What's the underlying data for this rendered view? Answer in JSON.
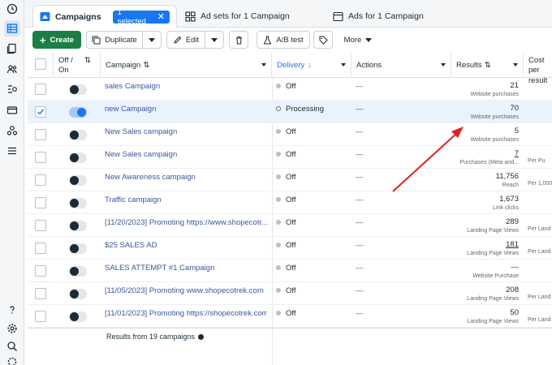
{
  "tabs": {
    "campaigns": "Campaigns",
    "selected_badge": "1 selected",
    "adsets": "Ad sets for 1 Campaign",
    "ads": "Ads for 1 Campaign"
  },
  "toolbar": {
    "create": "Create",
    "duplicate": "Duplicate",
    "edit": "Edit",
    "abtest": "A/B test",
    "more": "More"
  },
  "columns": {
    "offon": "Off / On",
    "campaign": "Campaign",
    "delivery": "Delivery",
    "actions": "Actions",
    "results": "Results",
    "cost": "Cost per result"
  },
  "rows": [
    {
      "name": "sales Campaign",
      "delivery": "Off",
      "action": "—",
      "result": "21",
      "result_label": "Website purchases",
      "cost_label": "",
      "toggle": false,
      "checked": false
    },
    {
      "name": "new Campaign",
      "delivery": "Processing",
      "action": "—",
      "result": "70",
      "result_label": "Website purchases",
      "cost_label": "",
      "toggle": true,
      "checked": true
    },
    {
      "name": "New Sales campaign",
      "delivery": "Off",
      "action": "—",
      "result": "5",
      "result_label": "Website purchases",
      "cost_label": "",
      "toggle": false,
      "checked": false
    },
    {
      "name": "New Sales campaign",
      "delivery": "Off",
      "action": "—",
      "result": "7",
      "result_label": "Purchases (Meta and...",
      "cost_label": "Per Pu",
      "toggle": false,
      "checked": false
    },
    {
      "name": "New Awareness campaign",
      "delivery": "Off",
      "action": "—",
      "result": "11,756",
      "result_label": "Reach",
      "cost_label": "Per 1,000",
      "toggle": false,
      "checked": false
    },
    {
      "name": "Traffic campaign",
      "delivery": "Off",
      "action": "—",
      "result": "1,673",
      "result_label": "Link clicks",
      "cost_label": "",
      "toggle": false,
      "checked": false
    },
    {
      "name": "[11/20/2023] Promoting https://www.shopecotr...",
      "delivery": "Off",
      "action": "—",
      "result": "289",
      "result_label": "Landing Page Views",
      "cost_label": "Per Land",
      "toggle": false,
      "checked": false
    },
    {
      "name": "$25 SALES AD",
      "delivery": "Off",
      "action": "—",
      "result": "181",
      "result_label": "Landing Page Views",
      "cost_label": "Per Land",
      "toggle": false,
      "checked": false
    },
    {
      "name": "SALES ATTEMPT #1 Campaign",
      "delivery": "Off",
      "action": "—",
      "result": "—",
      "result_label": "Website Purchase",
      "cost_label": "",
      "toggle": false,
      "checked": false
    },
    {
      "name": "[11/05/2023] Promoting www.shopecotrek.com",
      "delivery": "Off",
      "action": "—",
      "result": "208",
      "result_label": "Landing Page Views",
      "cost_label": "Per Land",
      "toggle": false,
      "checked": false
    },
    {
      "name": "[11/01/2023] Promoting https://shopecotrek.com/",
      "delivery": "Off",
      "action": "—",
      "result": "50",
      "result_label": "Landing Page Views",
      "cost_label": "Per Land",
      "toggle": false,
      "checked": false
    }
  ],
  "footer": {
    "text": "Results from 19 campaigns"
  },
  "colors": {
    "accent": "#1877f2",
    "create": "#1a7f44",
    "annotation": "#e02020"
  }
}
